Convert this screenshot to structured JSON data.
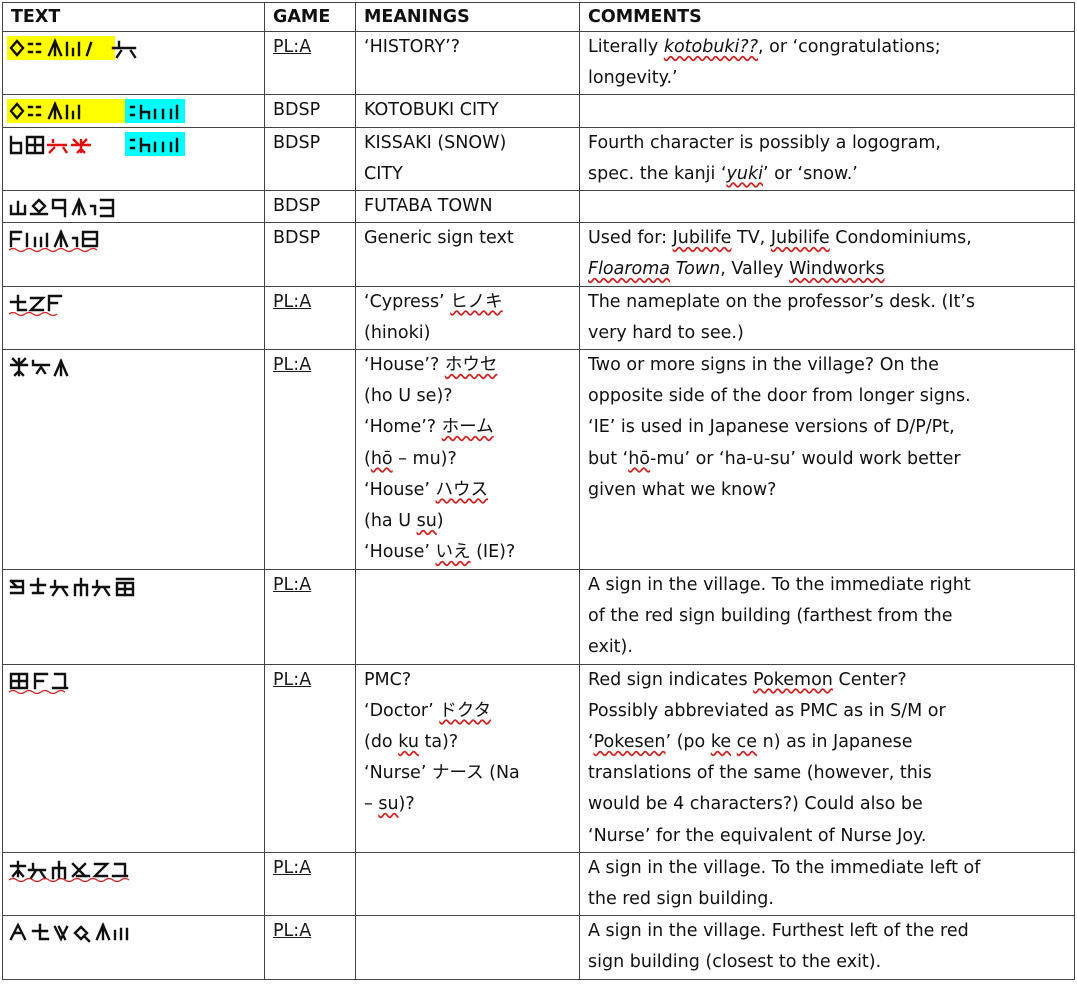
{
  "headers": {
    "text": "TEXT",
    "game": "GAME",
    "meanings": "MEANINGS",
    "comments": "COMMENTS"
  },
  "rows": [
    {
      "game": "PL:A",
      "m": [
        "‘HISTORY’?"
      ],
      "c": [
        "Literally ",
        "kotobuki??",
        ", or ‘congratulations;",
        "longevity.’"
      ]
    },
    {
      "game": "BDSP",
      "m": [
        "KOTOBUKI CITY"
      ],
      "c": []
    },
    {
      "game": "BDSP",
      "m": [
        "KISSAKI (SNOW)",
        "CITY"
      ],
      "c": [
        "Fourth character is possibly a logogram,",
        "spec. the kanji ‘",
        "yuki",
        "’ or ‘snow.’"
      ]
    },
    {
      "game": "BDSP",
      "m": [
        "FUTABA TOWN"
      ],
      "c": []
    },
    {
      "game": "BDSP",
      "m": [
        "Generic sign text"
      ],
      "c": [
        "Used for: ",
        "Jubilife",
        " TV, ",
        "Jubilife",
        " Condominiums,",
        "Floaroma",
        " Town",
        ", Valley ",
        "Windworks"
      ]
    },
    {
      "game": "PL:A",
      "m": [
        "‘Cypress’ ",
        "ヒノキ",
        "(hinoki)"
      ],
      "c": [
        "The nameplate on the professor’s desk. (It’s",
        "very hard to see.)"
      ]
    },
    {
      "game": "PL:A",
      "m": [
        "‘House’? ",
        "ホウセ",
        "(ho U se)?",
        "‘Home’? ",
        "ホーム",
        "(",
        "hō",
        " – mu)?",
        "‘House’ ",
        "ハウス",
        "(ha U ",
        "su",
        ")",
        "‘House’ ",
        "いえ",
        " (IE)?"
      ],
      "c": [
        "Two or more signs in the village? On the",
        "opposite side of the door from longer signs.",
        "‘IE’ is used in Japanese versions of D/P/Pt,",
        "but ‘",
        "hō",
        "-mu’ or ‘ha-u-su’ would work better",
        "given what we know?"
      ]
    },
    {
      "game": "PL:A",
      "m": [],
      "c": [
        "A sign in the village. To the immediate right",
        "of the red sign building (farthest from the",
        "exit)."
      ]
    },
    {
      "game": "PL:A",
      "m": [
        "PMC?",
        "‘Doctor’ ",
        "ドクタ",
        "(do ",
        "ku",
        " ta)?",
        "‘Nurse’ ナース (Na",
        "– ",
        "su",
        ")?"
      ],
      "c": [
        "Red sign indicates ",
        "Pokemon",
        " Center?",
        "Possibly abbreviated as PMC as in S/M or",
        "‘",
        "Pokesen",
        "’ (po ",
        "ke",
        " ",
        "ce",
        " n) as in Japanese",
        "translations of the same (however, this",
        "would be 4 characters?) Could also be",
        "‘Nurse’ for the equivalent of Nurse Joy."
      ]
    },
    {
      "game": "PL:A",
      "m": [],
      "c": [
        "A sign in the village. To the immediate left of",
        "the red sign building."
      ]
    },
    {
      "game": "PL:A",
      "m": [],
      "c": [
        "A sign in the village. Furthest left of the red",
        "sign building (closest to the exit)."
      ]
    }
  ],
  "colors": {
    "highlight_yellow": "#ffff00",
    "highlight_cyan": "#00ffff",
    "glyph_red": "#e01010",
    "spell_squiggle": "#d02020"
  }
}
